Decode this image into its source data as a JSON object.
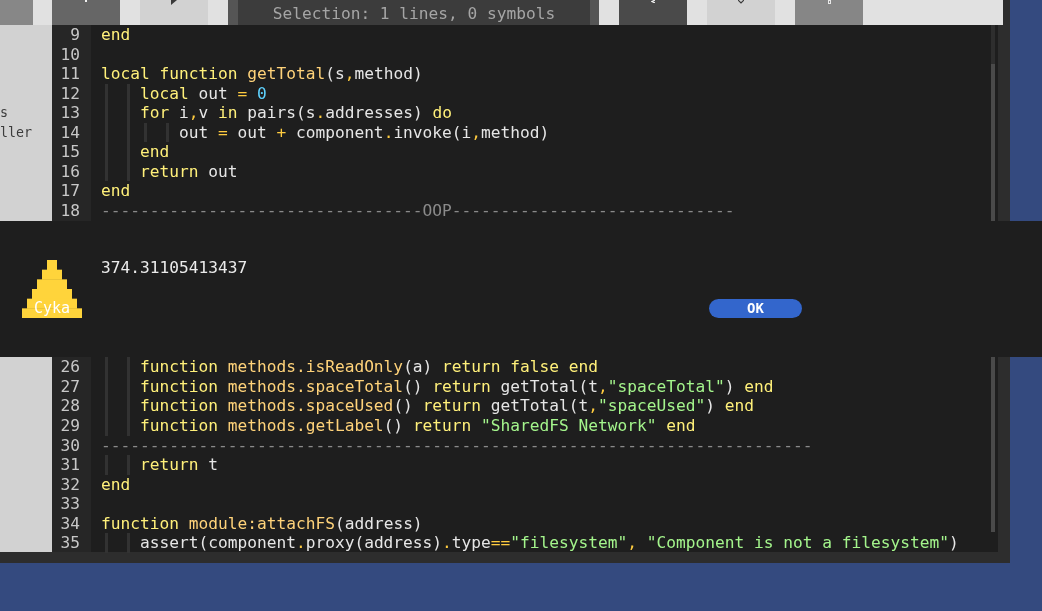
{
  "toolbar": {
    "status_text": "Selection: 1 lines, 0 symbols"
  },
  "file_panel": {
    "items": [
      "s",
      "ller"
    ]
  },
  "editor": {
    "lines_above": [
      {
        "number": "9",
        "tokens": [
          {
            "kind": "keyword",
            "text": "end"
          }
        ]
      },
      {
        "number": "10"
      },
      {
        "number": "11",
        "tokens": [
          {
            "kind": "keyword",
            "text": "local function "
          },
          {
            "kind": "function",
            "text": "getTotal"
          },
          {
            "kind": "plain",
            "text": "(s"
          },
          {
            "kind": "operator",
            "text": ","
          },
          {
            "kind": "plain",
            "text": "method)"
          }
        ]
      },
      {
        "number": "12",
        "tokens": [
          {
            "kind": "indent"
          },
          {
            "kind": "keyword",
            "text": "local "
          },
          {
            "kind": "plain",
            "text": "out "
          },
          {
            "kind": "operator",
            "text": "= "
          },
          {
            "kind": "number",
            "text": "0"
          }
        ]
      },
      {
        "number": "13",
        "tokens": [
          {
            "kind": "indent"
          },
          {
            "kind": "keyword",
            "text": "for "
          },
          {
            "kind": "plain",
            "text": "i"
          },
          {
            "kind": "operator",
            "text": ","
          },
          {
            "kind": "plain",
            "text": "v "
          },
          {
            "kind": "keyword",
            "text": "in "
          },
          {
            "kind": "plain",
            "text": "pairs(s"
          },
          {
            "kind": "operator",
            "text": "."
          },
          {
            "kind": "plain",
            "text": "addresses) "
          },
          {
            "kind": "keyword",
            "text": "do"
          }
        ]
      },
      {
        "number": "14",
        "tokens": [
          {
            "kind": "indent"
          },
          {
            "kind": "indent"
          },
          {
            "kind": "plain",
            "text": "out "
          },
          {
            "kind": "operator",
            "text": "= "
          },
          {
            "kind": "plain",
            "text": "out "
          },
          {
            "kind": "operator",
            "text": "+ "
          },
          {
            "kind": "plain",
            "text": "component"
          },
          {
            "kind": "operator",
            "text": "."
          },
          {
            "kind": "plain",
            "text": "invoke(i"
          },
          {
            "kind": "operator",
            "text": ","
          },
          {
            "kind": "plain",
            "text": "method)"
          }
        ]
      },
      {
        "number": "15",
        "tokens": [
          {
            "kind": "indent"
          },
          {
            "kind": "keyword",
            "text": "end"
          }
        ]
      },
      {
        "number": "16",
        "tokens": [
          {
            "kind": "indent"
          },
          {
            "kind": "keyword",
            "text": "return "
          },
          {
            "kind": "plain",
            "text": "out"
          }
        ]
      },
      {
        "number": "17",
        "tokens": [
          {
            "kind": "keyword",
            "text": "end"
          }
        ]
      },
      {
        "number": "18",
        "tokens": [
          {
            "kind": "comment",
            "text": "---------------------------------OOP-----------------------------"
          }
        ]
      }
    ],
    "lines_below": [
      {
        "number": "26",
        "tokens": [
          {
            "kind": "indent"
          },
          {
            "kind": "keyword",
            "text": "function "
          },
          {
            "kind": "function",
            "text": "methods.isReadOnly"
          },
          {
            "kind": "plain",
            "text": "(a) "
          },
          {
            "kind": "keyword",
            "text": "return false end"
          }
        ]
      },
      {
        "number": "27",
        "tokens": [
          {
            "kind": "indent"
          },
          {
            "kind": "keyword",
            "text": "function "
          },
          {
            "kind": "function",
            "text": "methods.spaceTotal"
          },
          {
            "kind": "plain",
            "text": "() "
          },
          {
            "kind": "keyword",
            "text": "return "
          },
          {
            "kind": "plain",
            "text": "getTotal(t"
          },
          {
            "kind": "operator",
            "text": ","
          },
          {
            "kind": "string",
            "text": "\"spaceTotal\""
          },
          {
            "kind": "plain",
            "text": ") "
          },
          {
            "kind": "keyword",
            "text": "end"
          }
        ]
      },
      {
        "number": "28",
        "tokens": [
          {
            "kind": "indent"
          },
          {
            "kind": "keyword",
            "text": "function "
          },
          {
            "kind": "function",
            "text": "methods.spaceUsed"
          },
          {
            "kind": "plain",
            "text": "() "
          },
          {
            "kind": "keyword",
            "text": "return "
          },
          {
            "kind": "plain",
            "text": "getTotal(t"
          },
          {
            "kind": "operator",
            "text": ","
          },
          {
            "kind": "string",
            "text": "\"spaceUsed\""
          },
          {
            "kind": "plain",
            "text": ") "
          },
          {
            "kind": "keyword",
            "text": "end"
          }
        ]
      },
      {
        "number": "29",
        "tokens": [
          {
            "kind": "indent"
          },
          {
            "kind": "keyword",
            "text": "function "
          },
          {
            "kind": "function",
            "text": "methods.getLabel"
          },
          {
            "kind": "plain",
            "text": "() "
          },
          {
            "kind": "keyword",
            "text": "return "
          },
          {
            "kind": "string",
            "text": "\"SharedFS Network\""
          },
          {
            "kind": "keyword",
            "text": " end"
          }
        ]
      },
      {
        "number": "30",
        "tokens": [
          {
            "kind": "comment",
            "text": "-------------------------------------------------------------------------"
          }
        ]
      },
      {
        "number": "31",
        "tokens": [
          {
            "kind": "indent"
          },
          {
            "kind": "keyword",
            "text": "return "
          },
          {
            "kind": "plain",
            "text": "t"
          }
        ]
      },
      {
        "number": "32",
        "tokens": [
          {
            "kind": "keyword",
            "text": "end"
          }
        ]
      },
      {
        "number": "33"
      },
      {
        "number": "34",
        "tokens": [
          {
            "kind": "keyword",
            "text": "function "
          },
          {
            "kind": "function",
            "text": "module:attachFS"
          },
          {
            "kind": "plain",
            "text": "(address)"
          }
        ]
      },
      {
        "number": "35",
        "tokens": [
          {
            "kind": "indent"
          },
          {
            "kind": "plain",
            "text": "assert(component"
          },
          {
            "kind": "operator",
            "text": "."
          },
          {
            "kind": "plain",
            "text": "proxy(address)"
          },
          {
            "kind": "operator",
            "text": "."
          },
          {
            "kind": "plain",
            "text": "type"
          },
          {
            "kind": "operator",
            "text": "=="
          },
          {
            "kind": "string",
            "text": "\"filesystem\""
          },
          {
            "kind": "operator",
            "text": ", "
          },
          {
            "kind": "string",
            "text": "\"Component is not a filesystem\""
          },
          {
            "kind": "plain",
            "text": ")"
          }
        ]
      }
    ]
  },
  "dialog": {
    "icon_label": "Cyka",
    "message": "374.31105413437",
    "button": "OK"
  }
}
